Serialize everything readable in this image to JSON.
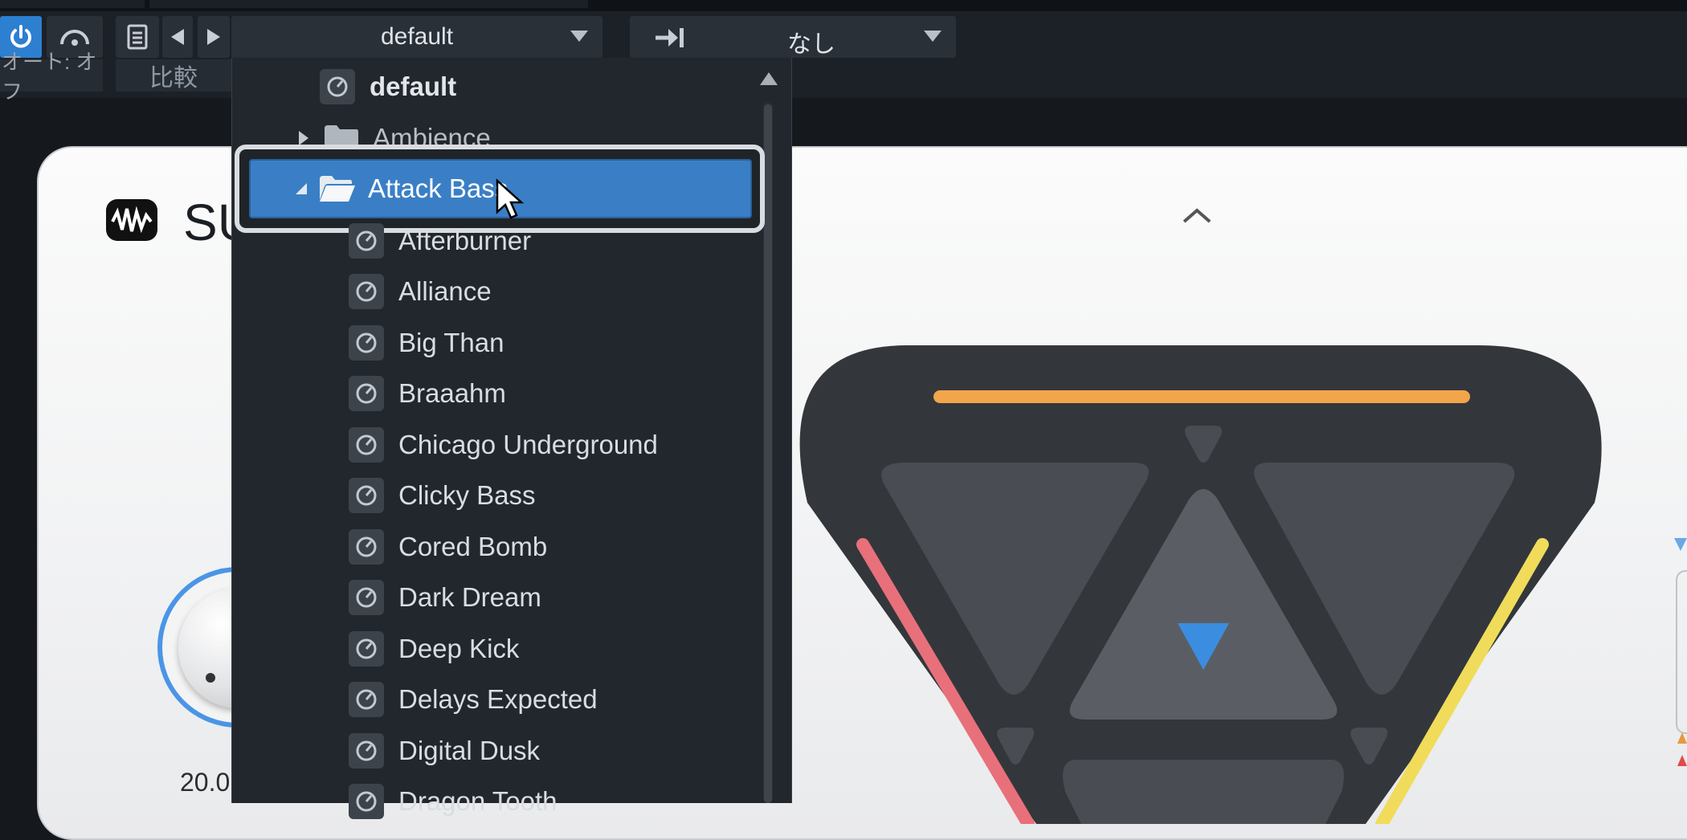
{
  "toolbar": {
    "preset_name": "default",
    "sidechain": "なし",
    "auto_label": "オート: オフ",
    "compare_label": "比較"
  },
  "plugin": {
    "title_visible": "SU",
    "knob_value": "20.0"
  },
  "dropdown": {
    "default_item": "default",
    "folder_collapsed": "Ambience",
    "folder_open": "Attack Bass",
    "presets": [
      "Afterburner",
      "Alliance",
      "Big Than",
      "Braaahm",
      "Chicago Underground",
      "Clicky Bass",
      "Cored Bomb",
      "Dark Dream",
      "Deep Kick",
      "Delays Expected",
      "Digital Dusk",
      "Dragon Tooth"
    ]
  },
  "colors": {
    "accent_blue": "#2d7fd0",
    "selection_blue": "#3a7fc6",
    "pad_orange": "#f2a54a",
    "pad_red": "#e8707a",
    "pad_yellow": "#f0dc5a",
    "pad_pointer": "#3b8de0"
  },
  "icons": [
    "power-icon",
    "listen-icon",
    "file-icon",
    "prev-arrow-icon",
    "next-arrow-icon",
    "sidechain-icon",
    "preset-icon",
    "folder-icon",
    "folder-open-icon",
    "cursor-icon",
    "collapse-icon",
    "logo-icon"
  ]
}
